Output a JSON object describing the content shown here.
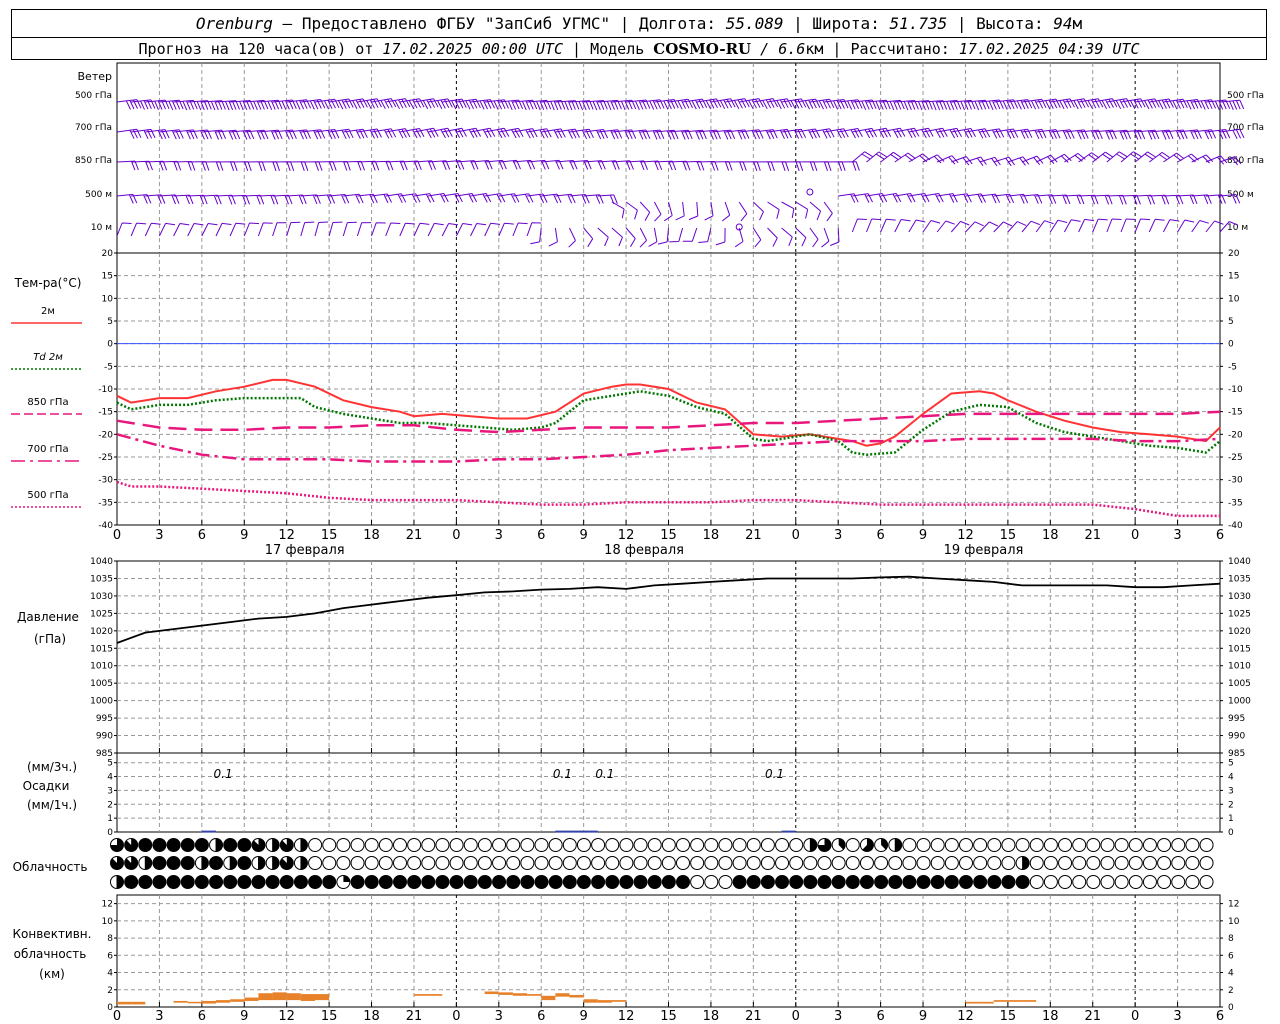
{
  "header": {
    "city": "Orenburg",
    "dash": " — ",
    "provider": "Предоставлено ФГБУ \"ЗапСиб УГМС\"",
    "sep": " | ",
    "lon_label": "Долгота: ",
    "lon": "55.089",
    "lat_label": "Широта: ",
    "lat": "51.735",
    "alt_label": "Высота: ",
    "alt": "94",
    "alt_unit": "м",
    "forecast_label": "Прогноз на 120 часа(ов) от ",
    "forecast_time": "17.02.2025 00:00 UTC",
    "model_label": "Модель ",
    "model": "COSMO-RU",
    "model_res": " / 6.6",
    "model_res_unit": "км",
    "calc_label": "Рассчитано: ",
    "calc_time": "17.02.2025 04:39 UTC"
  },
  "chart_data": {
    "type": "line",
    "x_ticks": [
      "0",
      "3",
      "6",
      "9",
      "12",
      "15",
      "18",
      "21",
      "0",
      "3",
      "6",
      "9",
      "12",
      "15",
      "18",
      "21",
      "0",
      "3",
      "6",
      "9",
      "12",
      "15",
      "18",
      "21",
      "0",
      "3",
      "6"
    ],
    "days": [
      {
        "label": "17 февраля",
        "at_hour": 12
      },
      {
        "label": "18 февраля",
        "at_hour": 36
      },
      {
        "label": "19 февраля",
        "at_hour": 60
      }
    ],
    "wind": {
      "title": "Ветер",
      "levels": [
        "500 гПа",
        "700 гПа",
        "850 гПа",
        "500 м",
        "10 м"
      ],
      "calm_marks_at_hour": [
        44,
        49
      ]
    },
    "temperature": {
      "title": "Тем-ра(°C)",
      "ylim": [
        -40,
        20
      ],
      "yticks": [
        20,
        15,
        10,
        5,
        0,
        -5,
        -10,
        -15,
        -20,
        -25,
        -30,
        -35,
        -40
      ],
      "zero_line": 0,
      "series": [
        {
          "name": "2м",
          "color": "#ff3333",
          "style": "solid",
          "x": [
            0,
            1,
            3,
            5,
            7,
            9,
            11,
            12,
            14,
            16,
            18,
            20,
            21,
            23,
            25,
            27,
            29,
            31,
            33,
            35,
            36,
            37,
            39,
            41,
            43,
            45,
            47,
            49,
            51,
            52,
            53,
            54,
            55,
            57,
            59,
            61,
            62,
            63,
            65,
            67,
            69,
            71,
            73,
            75,
            77,
            78
          ],
          "y": [
            -11.5,
            -13,
            -12,
            -12,
            -10.5,
            -9.5,
            -8,
            -8,
            -9.5,
            -12.5,
            -14,
            -15,
            -16,
            -15.5,
            -16,
            -16.5,
            -16.5,
            -15,
            -11,
            -9.5,
            -9,
            -9,
            -10,
            -13,
            -14.5,
            -20,
            -20.5,
            -20,
            -21,
            -21.5,
            -22.5,
            -22,
            -20.5,
            -15.5,
            -11,
            -10.5,
            -11,
            -12.5,
            -15,
            -17,
            -18.5,
            -19.5,
            -20,
            -20.5,
            -21.5,
            -18.5
          ]
        },
        {
          "name": "Td 2м",
          "color": "#007700",
          "style": "dotted",
          "x": [
            0,
            1,
            3,
            5,
            7,
            9,
            11,
            12,
            13,
            14,
            16,
            18,
            20,
            22,
            24,
            26,
            28,
            30,
            31,
            33,
            35,
            37,
            39,
            41,
            43,
            45,
            46,
            47,
            49,
            51,
            52,
            53,
            55,
            57,
            59,
            61,
            63,
            65,
            67,
            69,
            71,
            73,
            75,
            77,
            78
          ],
          "y": [
            -13,
            -14.5,
            -13.5,
            -13.5,
            -12.5,
            -12,
            -12,
            -12,
            -12,
            -14,
            -15.5,
            -16.5,
            -17.5,
            -17.5,
            -18,
            -18.5,
            -19,
            -18.5,
            -17.5,
            -12.5,
            -11.5,
            -10.5,
            -11.5,
            -14,
            -15.5,
            -21,
            -21.5,
            -21,
            -20,
            -21.5,
            -24,
            -24.5,
            -24,
            -19,
            -15,
            -13.5,
            -14,
            -17.5,
            -19.5,
            -20.5,
            -21.5,
            -22.5,
            -23,
            -24,
            -21.5
          ]
        },
        {
          "name": "850 гПа",
          "color": "#e8177d",
          "style": "longdash",
          "x": [
            0,
            3,
            6,
            9,
            12,
            15,
            18,
            21,
            24,
            27,
            30,
            33,
            36,
            39,
            42,
            45,
            48,
            51,
            54,
            57,
            60,
            63,
            66,
            69,
            72,
            75,
            78
          ],
          "y": [
            -17,
            -18.5,
            -19,
            -19,
            -18.5,
            -18.5,
            -18,
            -18,
            -19,
            -19.5,
            -19,
            -18.5,
            -18.5,
            -18.5,
            -18,
            -17.5,
            -17.5,
            -17,
            -16.5,
            -16,
            -15.5,
            -15.5,
            -15.5,
            -15.5,
            -15.5,
            -15.5,
            -15
          ]
        },
        {
          "name": "700 гПа",
          "color": "#e8177d",
          "style": "dashdot",
          "x": [
            0,
            3,
            6,
            9,
            12,
            15,
            18,
            21,
            24,
            27,
            30,
            33,
            36,
            39,
            42,
            45,
            48,
            51,
            54,
            57,
            60,
            63,
            66,
            69,
            72,
            75,
            78
          ],
          "y": [
            -20,
            -22.5,
            -24.5,
            -25.5,
            -25.5,
            -25.5,
            -26,
            -26,
            -26,
            -25.5,
            -25.5,
            -25,
            -24.5,
            -23.5,
            -23,
            -22.5,
            -22,
            -21.5,
            -21.5,
            -21.5,
            -21,
            -21,
            -21,
            -21,
            -21.5,
            -21.5,
            -21
          ]
        },
        {
          "name": "500 гПа",
          "color": "#e8177d",
          "style": "dotted",
          "x": [
            0,
            1,
            3,
            6,
            9,
            12,
            15,
            18,
            21,
            24,
            27,
            30,
            33,
            36,
            39,
            42,
            45,
            48,
            51,
            54,
            57,
            60,
            63,
            66,
            69,
            72,
            74,
            75,
            78
          ],
          "y": [
            -30.5,
            -31.5,
            -31.5,
            -32,
            -32.5,
            -33,
            -34,
            -34.5,
            -34.5,
            -34.5,
            -35,
            -35.5,
            -35.5,
            -35,
            -35,
            -35,
            -34.5,
            -34.5,
            -35,
            -35.5,
            -35.5,
            -35.5,
            -35.5,
            -35.5,
            -35.5,
            -36.5,
            -37.5,
            -38,
            -38
          ]
        }
      ]
    },
    "pressure": {
      "title": "Давление",
      "unit": "(гПа)",
      "ylim": [
        985,
        1040
      ],
      "yticks": [
        1040,
        1035,
        1030,
        1025,
        1020,
        1015,
        1010,
        1005,
        1000,
        995,
        990,
        985
      ],
      "series": [
        {
          "color": "#000000",
          "x": [
            0,
            2,
            4,
            6,
            8,
            10,
            12,
            14,
            16,
            18,
            20,
            22,
            24,
            26,
            28,
            30,
            32,
            34,
            36,
            38,
            40,
            42,
            44,
            46,
            48,
            50,
            52,
            54,
            56,
            58,
            60,
            62,
            64,
            66,
            68,
            70,
            72,
            74,
            76,
            78
          ],
          "y": [
            1016.5,
            1019.5,
            1020.5,
            1021.5,
            1022.5,
            1023.5,
            1024,
            1025,
            1026.5,
            1027.5,
            1028.5,
            1029.5,
            1030.2,
            1031,
            1031.3,
            1031.8,
            1032,
            1032.5,
            1032,
            1033,
            1033.5,
            1034,
            1034.5,
            1035,
            1035,
            1035,
            1035,
            1035.3,
            1035.5,
            1035,
            1034.5,
            1034,
            1033,
            1033,
            1033,
            1033,
            1032.5,
            1032.5,
            1033,
            1033.5
          ]
        }
      ]
    },
    "precipitation": {
      "title": "Осадки",
      "unit_top": "(мм/3ч.)",
      "unit_bottom": "(мм/1ч.)",
      "ylim": [
        0,
        5
      ],
      "yticks": [
        5,
        4,
        3,
        2,
        1,
        0
      ],
      "labels": [
        {
          "at_hour": 7.5,
          "text": "0.1"
        },
        {
          "at_hour": 31.5,
          "text": "0.1"
        },
        {
          "at_hour": 34.5,
          "text": "0.1"
        },
        {
          "at_hour": 46.5,
          "text": "0.1"
        }
      ],
      "bars": [
        {
          "from_hour": 6,
          "to_hour": 7,
          "value": 0.1
        },
        {
          "from_hour": 31,
          "to_hour": 34,
          "value": 0.1
        },
        {
          "from_hour": 47,
          "to_hour": 48,
          "value": 0.1
        }
      ]
    },
    "cloudiness": {
      "title": "Облачность",
      "scale": "oktas 0-8",
      "high": [
        6,
        7,
        8,
        8,
        8,
        8,
        8,
        4,
        8,
        8,
        7,
        4,
        7,
        4,
        0,
        0,
        0,
        0,
        0,
        0,
        0,
        0,
        0,
        0,
        0,
        0,
        0,
        0,
        0,
        0,
        0,
        0,
        0,
        0,
        0,
        0,
        0,
        0,
        0,
        0,
        0,
        0,
        0,
        0,
        0,
        0,
        0,
        0,
        0,
        4,
        6,
        3,
        0,
        5,
        3,
        4,
        0,
        0,
        0,
        0,
        0,
        0,
        0,
        0,
        0,
        0,
        0,
        0,
        0,
        0,
        0,
        0,
        0,
        0,
        0,
        0,
        0,
        0
      ],
      "mid": [
        7,
        7,
        4,
        8,
        8,
        8,
        4,
        8,
        4,
        8,
        4,
        4,
        7,
        4,
        0,
        0,
        0,
        0,
        0,
        0,
        0,
        0,
        0,
        0,
        0,
        0,
        0,
        0,
        0,
        0,
        0,
        0,
        0,
        0,
        0,
        0,
        0,
        0,
        0,
        0,
        0,
        0,
        0,
        0,
        0,
        0,
        0,
        0,
        0,
        0,
        0,
        0,
        0,
        0,
        0,
        0,
        0,
        0,
        0,
        0,
        0,
        0,
        0,
        0,
        4,
        0,
        0,
        0,
        0,
        0,
        0,
        0,
        0,
        0,
        0,
        0,
        0,
        0
      ],
      "low": [
        4,
        8,
        8,
        8,
        8,
        8,
        8,
        8,
        8,
        8,
        8,
        8,
        8,
        8,
        8,
        8,
        2,
        8,
        8,
        8,
        8,
        8,
        8,
        8,
        8,
        8,
        8,
        8,
        8,
        8,
        8,
        8,
        8,
        8,
        8,
        8,
        8,
        8,
        8,
        8,
        8,
        0,
        0,
        0,
        8,
        8,
        8,
        8,
        8,
        8,
        8,
        8,
        8,
        8,
        8,
        8,
        8,
        8,
        8,
        8,
        8,
        8,
        8,
        8,
        8,
        0,
        0,
        0,
        0,
        0,
        0,
        0,
        0,
        0,
        0,
        0,
        0,
        0
      ]
    },
    "convective": {
      "title_line1": "Конвективн.",
      "title_line2": "облачность",
      "unit": "(км)",
      "ylim": [
        0,
        13
      ],
      "yticks": [
        12,
        10,
        8,
        6,
        4,
        2,
        0
      ],
      "color": "#e8822a",
      "bars": [
        {
          "x": 0.5,
          "base": 0.3,
          "top": 0.6
        },
        {
          "x": 1.5,
          "base": 0.3,
          "top": 0.6
        },
        {
          "x": 4.5,
          "base": 0.5,
          "top": 0.7
        },
        {
          "x": 5.5,
          "base": 0.5,
          "top": 0.6
        },
        {
          "x": 6.5,
          "base": 0.4,
          "top": 0.7
        },
        {
          "x": 7.5,
          "base": 0.5,
          "top": 0.8
        },
        {
          "x": 8.5,
          "base": 0.6,
          "top": 0.9
        },
        {
          "x": 9.5,
          "base": 0.7,
          "top": 1.1
        },
        {
          "x": 10.5,
          "base": 0.8,
          "top": 1.6
        },
        {
          "x": 11.5,
          "base": 0.8,
          "top": 1.7
        },
        {
          "x": 12.5,
          "base": 0.8,
          "top": 1.6
        },
        {
          "x": 13.5,
          "base": 0.7,
          "top": 1.5
        },
        {
          "x": 14.5,
          "base": 0.8,
          "top": 1.5
        },
        {
          "x": 21.5,
          "base": 1.3,
          "top": 1.5
        },
        {
          "x": 22.5,
          "base": 1.3,
          "top": 1.5
        },
        {
          "x": 26.5,
          "base": 1.5,
          "top": 1.8
        },
        {
          "x": 27.5,
          "base": 1.4,
          "top": 1.7
        },
        {
          "x": 28.5,
          "base": 1.3,
          "top": 1.6
        },
        {
          "x": 29.5,
          "base": 1.3,
          "top": 1.5
        },
        {
          "x": 30.5,
          "base": 0.8,
          "top": 1.3
        },
        {
          "x": 31.5,
          "base": 1.2,
          "top": 1.6
        },
        {
          "x": 32.5,
          "base": 1.1,
          "top": 1.4
        },
        {
          "x": 33.5,
          "base": 0.5,
          "top": 0.9
        },
        {
          "x": 34.5,
          "base": 0.5,
          "top": 0.8
        },
        {
          "x": 35.5,
          "base": 0.6,
          "top": 0.8
        },
        {
          "x": 60.5,
          "base": 0.4,
          "top": 0.6
        },
        {
          "x": 61.5,
          "base": 0.4,
          "top": 0.6
        },
        {
          "x": 62.5,
          "base": 0.6,
          "top": 0.8
        },
        {
          "x": 63.5,
          "base": 0.6,
          "top": 0.8
        },
        {
          "x": 64.5,
          "base": 0.6,
          "top": 0.8
        }
      ]
    },
    "colors": {
      "grid": "#999999",
      "wind": "#6600cc",
      "zero_line": "#3355ff",
      "precip": "#3344aa"
    }
  }
}
